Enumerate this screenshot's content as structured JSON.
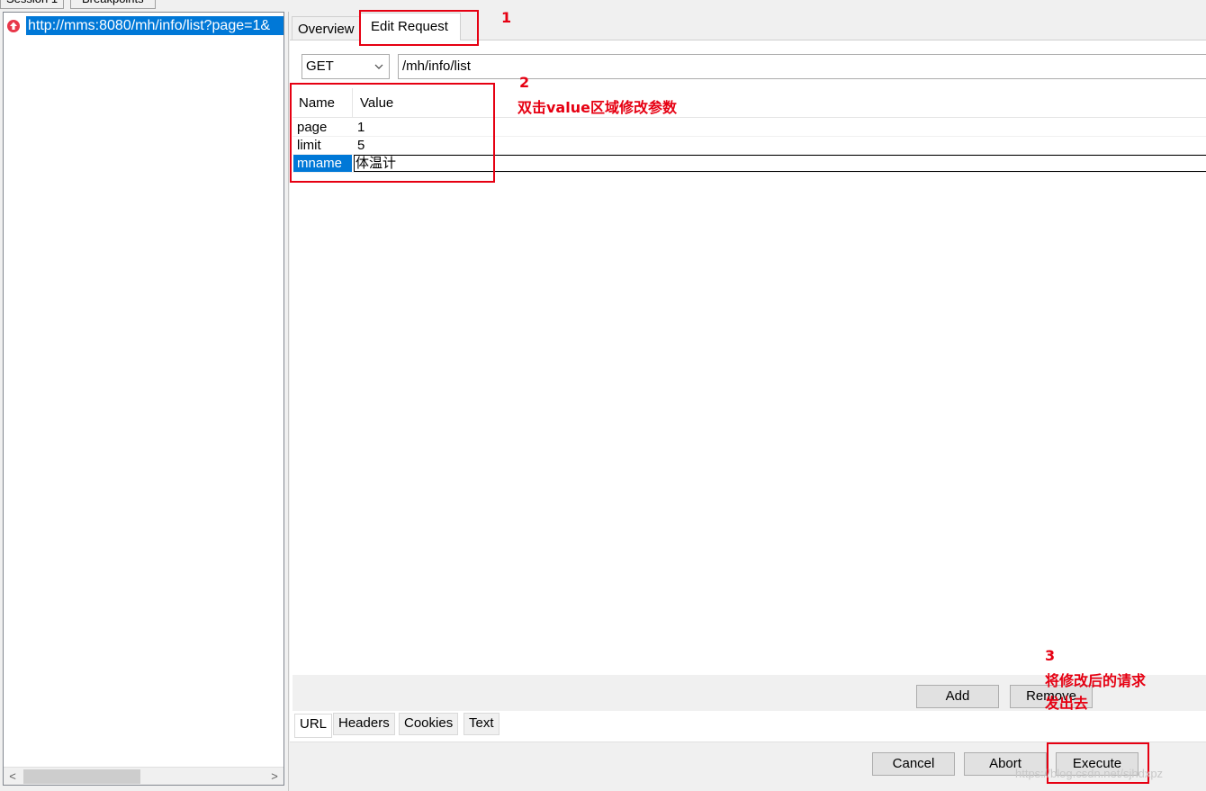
{
  "top_tabs": [
    "Session 1",
    "Breakpoints"
  ],
  "session": {
    "url": "http://mms:8080/mh/info/list?page=1&",
    "icon": "breakpoint-up-icon",
    "scroll_left": "<",
    "scroll_right": ">"
  },
  "tabs": {
    "overview": "Overview",
    "edit_request": "Edit Request"
  },
  "request": {
    "method": "GET",
    "path": "/mh/info/list"
  },
  "params": {
    "header_name": "Name",
    "header_value": "Value",
    "rows": [
      {
        "name": "page",
        "value": "1"
      },
      {
        "name": "limit",
        "value": "5"
      },
      {
        "name": "mname",
        "value": "体温计"
      }
    ]
  },
  "buttons": {
    "add": "Add",
    "remove": "Remove",
    "cancel": "Cancel",
    "abort": "Abort",
    "execute": "Execute"
  },
  "sub_tabs": [
    "URL",
    "Headers",
    "Cookies",
    "Text"
  ],
  "annotations": {
    "n1": "1",
    "n2": "2",
    "n2_text": "双击value区域修改参数",
    "n3": "3",
    "n3_line1": "将修改后的请求",
    "n3_line2": "发出去"
  },
  "watermark": "https://blog.csdn.net/sjhdxpz",
  "colors": {
    "selection": "#0078d7",
    "annotation": "#e60012"
  }
}
